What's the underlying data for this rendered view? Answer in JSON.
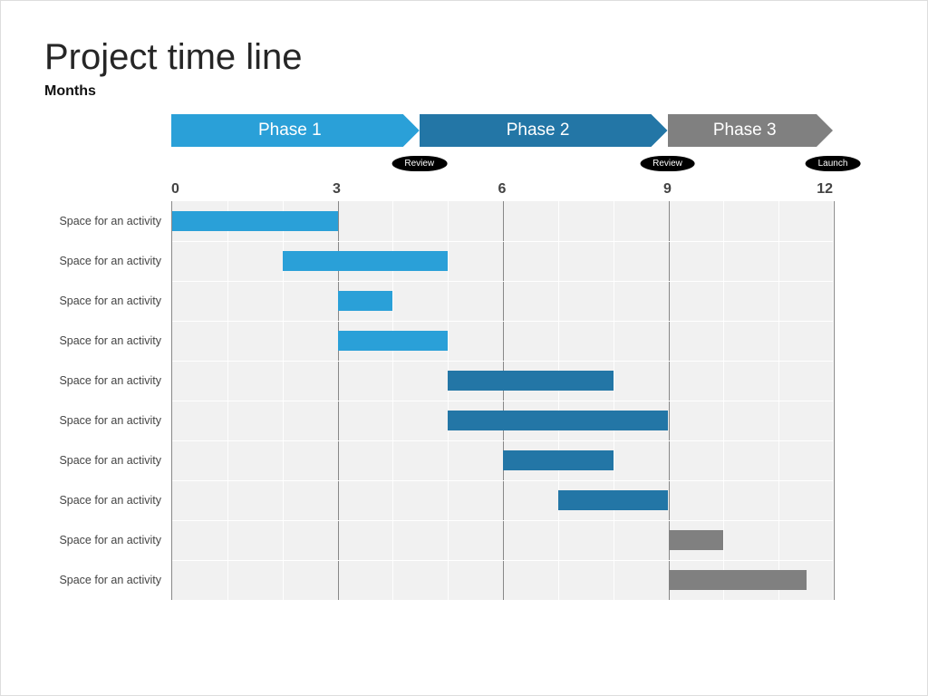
{
  "title": "Project time line",
  "subtitle": "Months",
  "chart_data": {
    "type": "bar",
    "orientation": "horizontal-gantt",
    "x_range": [
      0,
      12
    ],
    "ticks": [
      0,
      3,
      6,
      9,
      12
    ],
    "phases": [
      {
        "label": "Phase 1",
        "start": 0,
        "end": 4.5,
        "color": "#2aa0d8"
      },
      {
        "label": "Phase 2",
        "start": 4.5,
        "end": 9,
        "color": "#2376a6"
      },
      {
        "label": "Phase 3",
        "start": 9,
        "end": 12,
        "color": "#808080"
      }
    ],
    "milestones": [
      {
        "label": "Review",
        "x": 4.5
      },
      {
        "label": "Review",
        "x": 9
      },
      {
        "label": "Launch",
        "x": 12
      }
    ],
    "activities": [
      {
        "label": "Space for an activity",
        "start": 0.0,
        "end": 3.0,
        "color": "#2aa0d8"
      },
      {
        "label": "Space for an activity",
        "start": 2.0,
        "end": 5.0,
        "color": "#2aa0d8"
      },
      {
        "label": "Space for an activity",
        "start": 3.0,
        "end": 4.0,
        "color": "#2aa0d8"
      },
      {
        "label": "Space for an activity",
        "start": 3.0,
        "end": 5.0,
        "color": "#2aa0d8"
      },
      {
        "label": "Space for an activity",
        "start": 5.0,
        "end": 8.0,
        "color": "#2376a6"
      },
      {
        "label": "Space for an activity",
        "start": 5.0,
        "end": 9.0,
        "color": "#2376a6"
      },
      {
        "label": "Space for an activity",
        "start": 6.0,
        "end": 8.0,
        "color": "#2376a6"
      },
      {
        "label": "Space for an activity",
        "start": 7.0,
        "end": 9.0,
        "color": "#2376a6"
      },
      {
        "label": "Space for an activity",
        "start": 9.0,
        "end": 10.0,
        "color": "#808080"
      },
      {
        "label": "Space for an activity",
        "start": 9.0,
        "end": 11.5,
        "color": "#808080"
      }
    ]
  }
}
